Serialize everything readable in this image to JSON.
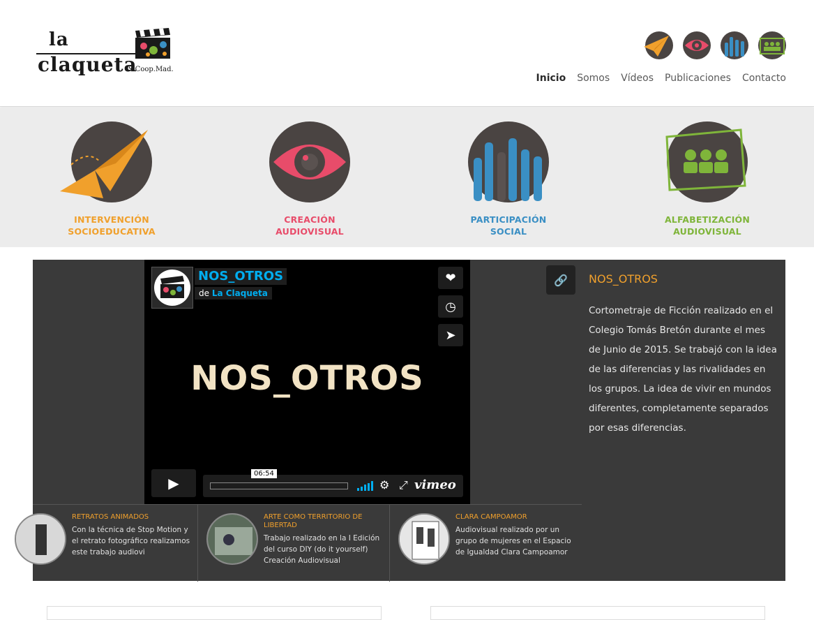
{
  "header": {
    "logo": {
      "line1": "la",
      "line2": "claqueta",
      "suffix": "S.Coop.Mad."
    },
    "icons": [
      "paper-plane-icon",
      "eye-icon",
      "hands-icon",
      "people-icon"
    ],
    "nav": [
      "Inicio",
      "Somos",
      "Vídeos",
      "Publicaciones",
      "Contacto"
    ]
  },
  "services": [
    {
      "label_1": "INTERVENCIÓN",
      "label_2": "SOCIOEDUCATIVA",
      "icon": "paper-plane-icon",
      "color": "#f0a02c"
    },
    {
      "label_1": "CREACIÓN",
      "label_2": "AUDIOVISUAL",
      "icon": "eye-icon",
      "color": "#e84c6a"
    },
    {
      "label_1": "PARTICIPACIÓN",
      "label_2": "SOCIAL",
      "icon": "hands-icon",
      "color": "#3a8fc4"
    },
    {
      "label_1": "ALFABETIZACIÓN",
      "label_2": "AUDIOVISUAL",
      "icon": "people-icon",
      "color": "#7fb53a"
    }
  ],
  "player": {
    "title": "NOS_OTROS",
    "by_prefix": "de",
    "by_author": "La Claqueta",
    "frame_text": "NOS_OTROS",
    "time": "06:54",
    "brand": "vimeo",
    "side_buttons": [
      "heart-icon",
      "clock-icon",
      "send-icon"
    ]
  },
  "description": {
    "title": "NOS_OTROS",
    "text": "Cortometraje de Ficción realizado en el Colegio Tomás Bretón durante el mes de Junio de 2015. Se trabajó con la idea de las diferencias y las rivalidades en los grupos. La idea de vivir en mundos diferentes, completamente separados por esas diferencias."
  },
  "thumbs": [
    {
      "title": "RETRATOS ANIMADOS",
      "text": "Con la técnica de Stop Motion y el retrato fotográfico realizamos este trabajo audiovi"
    },
    {
      "title": "ARTE COMO TERRITORIO DE LIBERTAD",
      "text": "Trabajo realizado en la I Edición del curso DIY (do it yourself) Creación Audiovisual"
    },
    {
      "title": "CLARA CAMPOAMOR",
      "text": "Audiovisual realizado por un grupo de mujeres en el Espacio de Igualdad Clara Campoamor"
    }
  ]
}
